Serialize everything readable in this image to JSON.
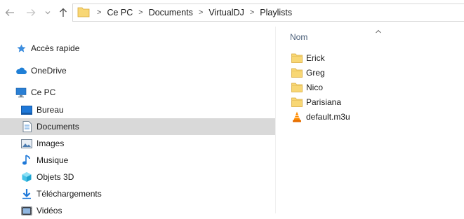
{
  "breadcrumb": [
    "Ce PC",
    "Documents",
    "VirtualDJ",
    "Playlists"
  ],
  "sidebar": {
    "items": [
      {
        "label": "Accès rapide",
        "icon": "star-icon"
      },
      {
        "label": "OneDrive",
        "icon": "cloud-icon"
      },
      {
        "label": "Ce PC",
        "icon": "computer-icon"
      },
      {
        "label": "Bureau",
        "icon": "desktop-icon"
      },
      {
        "label": "Documents",
        "icon": "document-icon",
        "selected": true
      },
      {
        "label": "Images",
        "icon": "image-icon"
      },
      {
        "label": "Musique",
        "icon": "music-icon"
      },
      {
        "label": "Objets 3D",
        "icon": "cube-icon"
      },
      {
        "label": "Téléchargements",
        "icon": "download-icon"
      },
      {
        "label": "Vidéos",
        "icon": "video-icon"
      }
    ]
  },
  "content": {
    "column_header": "Nom",
    "files": [
      {
        "name": "Erick",
        "icon": "folder-icon"
      },
      {
        "name": "Greg",
        "icon": "folder-icon"
      },
      {
        "name": "Nico",
        "icon": "folder-icon"
      },
      {
        "name": "Parisiana",
        "icon": "folder-icon"
      },
      {
        "name": "default.m3u",
        "icon": "vlc-icon"
      }
    ]
  },
  "colors": {
    "folder": "#f8d775",
    "selected_bg": "#d9d9d9",
    "header_text": "#4c607a",
    "accent_blue": "#1f7fd6"
  }
}
